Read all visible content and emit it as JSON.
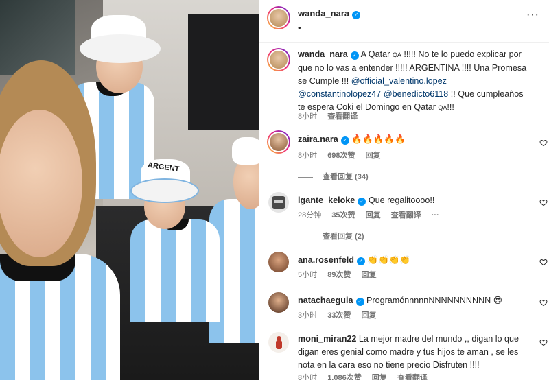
{
  "post": {
    "author": "wanda_nara",
    "verified_mark": "✓",
    "subtitle": "•",
    "more_label": "···"
  },
  "caption": {
    "username": "wanda_nara",
    "text_1": " A Qatar ",
    "flag_1": "QA",
    "text_2": " !!!!! No te lo puedo explicar por que no lo vas a entender !!!!! ARGENTINA !!!! Una Promesa se Cumple !!! ",
    "mention_1": "@official_valentino.lopez",
    "text_3": " ",
    "mention_2": "@constantinolopez47",
    "text_4": " ",
    "mention_3": "@benedicto6118",
    "text_5": " !! Que cumpleaños te espera Coki el Domingo en Qatar ",
    "flag_2": "QA",
    "text_6": "!!!",
    "time": "8小时",
    "translate": "查看翻译"
  },
  "comments": [
    {
      "username": "zaira.nara",
      "verified": true,
      "text": "🔥🔥🔥🔥🔥",
      "time": "8小时",
      "likes": "698次赞",
      "reply": "回复",
      "translate": "",
      "view_replies": "查看回复 (34)",
      "avatar_color": "#b07a4f"
    },
    {
      "username": "lgante_keloke",
      "verified": true,
      "text": "Que regalitoooo!!",
      "time": "28分钟",
      "likes": "35次赞",
      "reply": "回复",
      "translate": "查看翻译",
      "more": "···",
      "view_replies": "查看回复 (2)",
      "avatar_color": "#4a4a4a"
    },
    {
      "username": "ana.rosenfeld",
      "verified": true,
      "text": "👏👏👏👏",
      "time": "5小时",
      "likes": "89次赞",
      "reply": "回复",
      "translate": "",
      "view_replies": "",
      "avatar_color": "#8d5a3b"
    },
    {
      "username": "natachaeguia",
      "verified": true,
      "text": "ProgramónnnnnNNNNNNNNNN 😍",
      "time": "3小时",
      "likes": "33次赞",
      "reply": "回复",
      "translate": "",
      "view_replies": "",
      "avatar_color": "#6b3f2a"
    },
    {
      "username": "moni_miran22",
      "verified": false,
      "text": "La mejor madre del mundo ,, digan lo que digan eres genial como madre y tus hijos te aman , se les nota en la cara eso no tiene precio Disfruten !!!!",
      "time": "8小时",
      "likes": "1,086次赞",
      "reply": "回复",
      "translate": "查看翻译",
      "view_replies": "",
      "avatar_color": "#c0392b"
    }
  ],
  "colors": {
    "verified": "#0095f6",
    "mention": "#00376b",
    "meta": "#737373",
    "jersey_blue": "#8cc3ec"
  },
  "photo": {
    "hat_text": "ARGENT"
  }
}
